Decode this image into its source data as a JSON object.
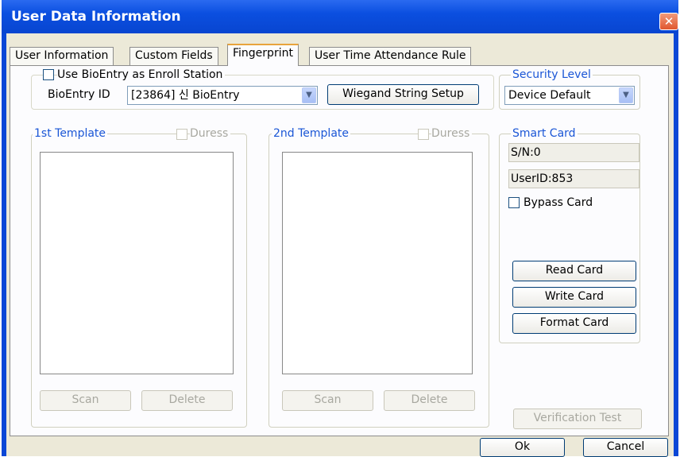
{
  "window": {
    "title": "User Data Information",
    "close_glyph": "✕"
  },
  "tabs": [
    {
      "label": "User Information"
    },
    {
      "label": "Custom Fields"
    },
    {
      "label": "Fingerprint"
    },
    {
      "label": "User Time Attendance Rule"
    }
  ],
  "bioentry": {
    "use_as_enroll_label": "Use BioEntry as Enroll Station",
    "id_label": "BioEntry ID",
    "id_value": "[23864] 신 BioEntry",
    "wiegand_button": "Wiegand String Setup"
  },
  "security": {
    "legend": "Security Level",
    "value": "Device Default"
  },
  "template1": {
    "legend": "1st Template",
    "duress_label": "Duress",
    "scan_label": "Scan",
    "delete_label": "Delete"
  },
  "template2": {
    "legend": "2nd Template",
    "duress_label": "Duress",
    "scan_label": "Scan",
    "delete_label": "Delete"
  },
  "smartcard": {
    "legend": "Smart Card",
    "serial": "S/N:0",
    "user_id": "UserID:853",
    "bypass_label": "Bypass Card",
    "read_label": "Read Card",
    "write_label": "Write Card",
    "format_label": "Format Card"
  },
  "verification_label": "Verification Test",
  "ok_label": "Ok",
  "cancel_label": "Cancel"
}
